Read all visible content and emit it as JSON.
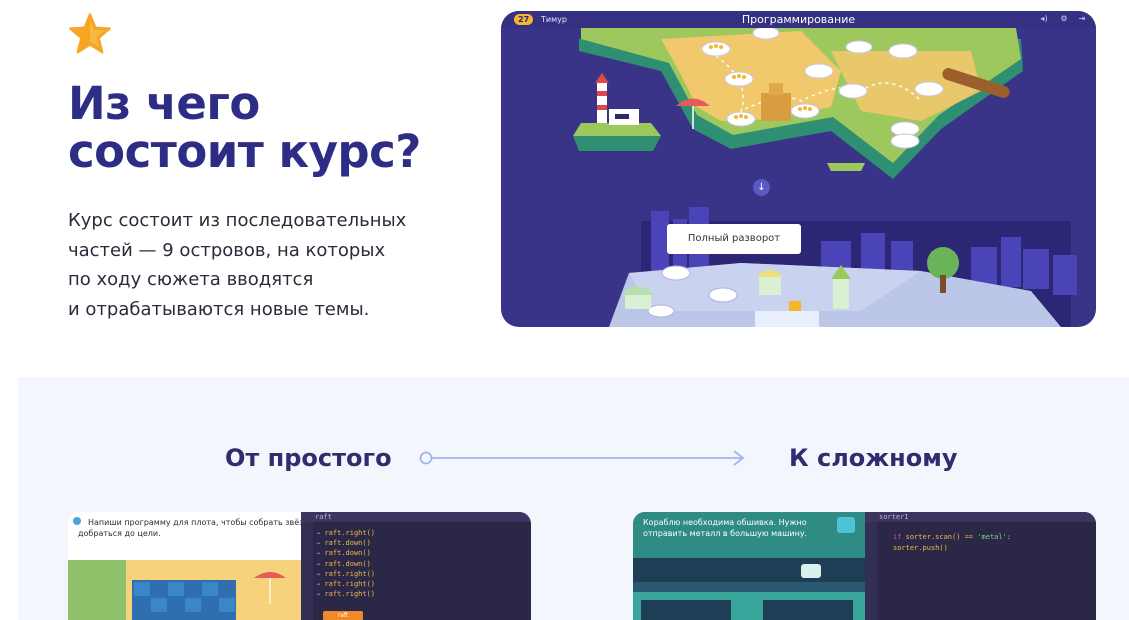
{
  "header": {
    "title_lines": [
      "Из чего",
      "состоит курс?"
    ],
    "description_lines": [
      "Курс состоит из последовательных",
      "частей — 9 островов, на которых",
      "по ходу сюжета вводятся",
      "и отрабатываются новые темы."
    ],
    "star_icon": "star-icon"
  },
  "hero": {
    "badge": "27",
    "user": "Тимур",
    "title": "Программирование",
    "controls": [
      "◂)",
      "⚙",
      "⇥"
    ],
    "tooltip": "Полный разворот",
    "down_icon": "↓"
  },
  "progression": {
    "from_label": "От простого",
    "to_label": "К сложному"
  },
  "task_simple": {
    "task_text_lines": [
      "Напиши программу для плота, чтобы собрать звёзды и",
      "добраться до цели."
    ],
    "editor_tab": "raft",
    "code_lines": [
      "raft.right()",
      "raft.down()",
      "raft.down()",
      "raft.down()",
      "raft.right()",
      "raft.right()",
      "raft.right()"
    ],
    "run_label": "raft"
  },
  "task_complex": {
    "task_text_lines": [
      "Кораблю необходима обшивка. Нужно",
      "отправить металл в большую машину."
    ],
    "editor_tab": "sorter1",
    "code_lines": [
      {
        "kw": "if",
        "rest": " sorter.scan() == ",
        "str": "'metal'",
        "end": ":"
      },
      {
        "kw": "",
        "rest": "    sorter.push()",
        "str": "",
        "end": ""
      }
    ]
  },
  "colors": {
    "accent": "#2e2d86",
    "hero_bg": "#3a3488",
    "island": "#f1c86c",
    "lower_bg": "#f3f6fd"
  }
}
